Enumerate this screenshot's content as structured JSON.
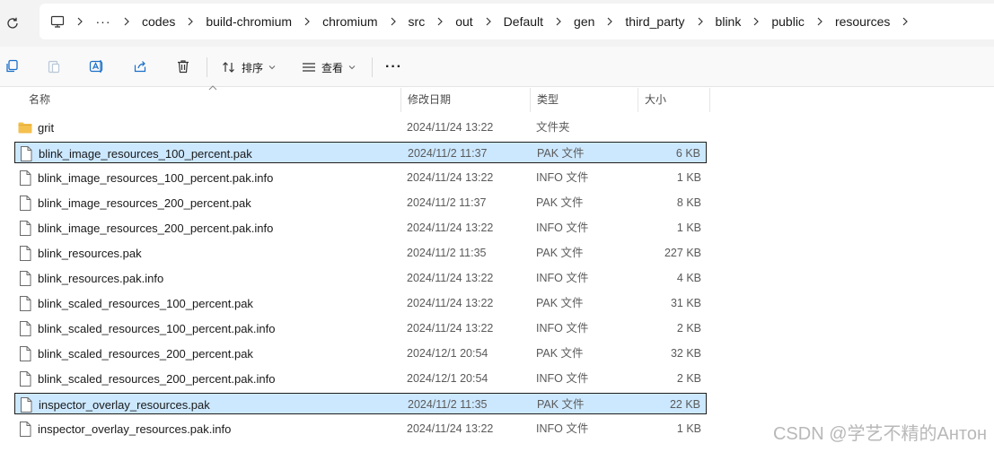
{
  "breadcrumb": {
    "items": [
      "codes",
      "build-chromium",
      "chromium",
      "src",
      "out",
      "Default",
      "gen",
      "third_party",
      "blink",
      "public",
      "resources"
    ],
    "more_label": "···"
  },
  "toolbar": {
    "sort_label": "排序",
    "view_label": "查看",
    "more_label": "···"
  },
  "columns": {
    "name": "名称",
    "date": "修改日期",
    "type": "类型",
    "size": "大小"
  },
  "files": [
    {
      "name": "grit",
      "date": "2024/11/24 13:22",
      "type": "文件夹",
      "size": "",
      "kind": "folder",
      "selected": false,
      "focused": false
    },
    {
      "name": "blink_image_resources_100_percent.pak",
      "date": "2024/11/2 11:37",
      "type": "PAK 文件",
      "size": "6 KB",
      "kind": "file",
      "selected": true,
      "focused": true
    },
    {
      "name": "blink_image_resources_100_percent.pak.info",
      "date": "2024/11/24 13:22",
      "type": "INFO 文件",
      "size": "1 KB",
      "kind": "file",
      "selected": false,
      "focused": false
    },
    {
      "name": "blink_image_resources_200_percent.pak",
      "date": "2024/11/2 11:37",
      "type": "PAK 文件",
      "size": "8 KB",
      "kind": "file",
      "selected": false,
      "focused": false
    },
    {
      "name": "blink_image_resources_200_percent.pak.info",
      "date": "2024/11/24 13:22",
      "type": "INFO 文件",
      "size": "1 KB",
      "kind": "file",
      "selected": false,
      "focused": false
    },
    {
      "name": "blink_resources.pak",
      "date": "2024/11/2 11:35",
      "type": "PAK 文件",
      "size": "227 KB",
      "kind": "file",
      "selected": false,
      "focused": false
    },
    {
      "name": "blink_resources.pak.info",
      "date": "2024/11/24 13:22",
      "type": "INFO 文件",
      "size": "4 KB",
      "kind": "file",
      "selected": false,
      "focused": false
    },
    {
      "name": "blink_scaled_resources_100_percent.pak",
      "date": "2024/11/24 13:22",
      "type": "PAK 文件",
      "size": "31 KB",
      "kind": "file",
      "selected": false,
      "focused": false
    },
    {
      "name": "blink_scaled_resources_100_percent.pak.info",
      "date": "2024/11/24 13:22",
      "type": "INFO 文件",
      "size": "2 KB",
      "kind": "file",
      "selected": false,
      "focused": false
    },
    {
      "name": "blink_scaled_resources_200_percent.pak",
      "date": "2024/12/1 20:54",
      "type": "PAK 文件",
      "size": "32 KB",
      "kind": "file",
      "selected": false,
      "focused": false
    },
    {
      "name": "blink_scaled_resources_200_percent.pak.info",
      "date": "2024/12/1 20:54",
      "type": "INFO 文件",
      "size": "2 KB",
      "kind": "file",
      "selected": false,
      "focused": false
    },
    {
      "name": "inspector_overlay_resources.pak",
      "date": "2024/11/2 11:35",
      "type": "PAK 文件",
      "size": "22 KB",
      "kind": "file",
      "selected": true,
      "focused": true
    },
    {
      "name": "inspector_overlay_resources.pak.info",
      "date": "2024/11/24 13:22",
      "type": "INFO 文件",
      "size": "1 KB",
      "kind": "file",
      "selected": false,
      "focused": false
    }
  ],
  "watermark": "CSDN @学艺不精的Антон",
  "colors": {
    "selection": "#cce8ff",
    "folder": "#f4c04e"
  }
}
